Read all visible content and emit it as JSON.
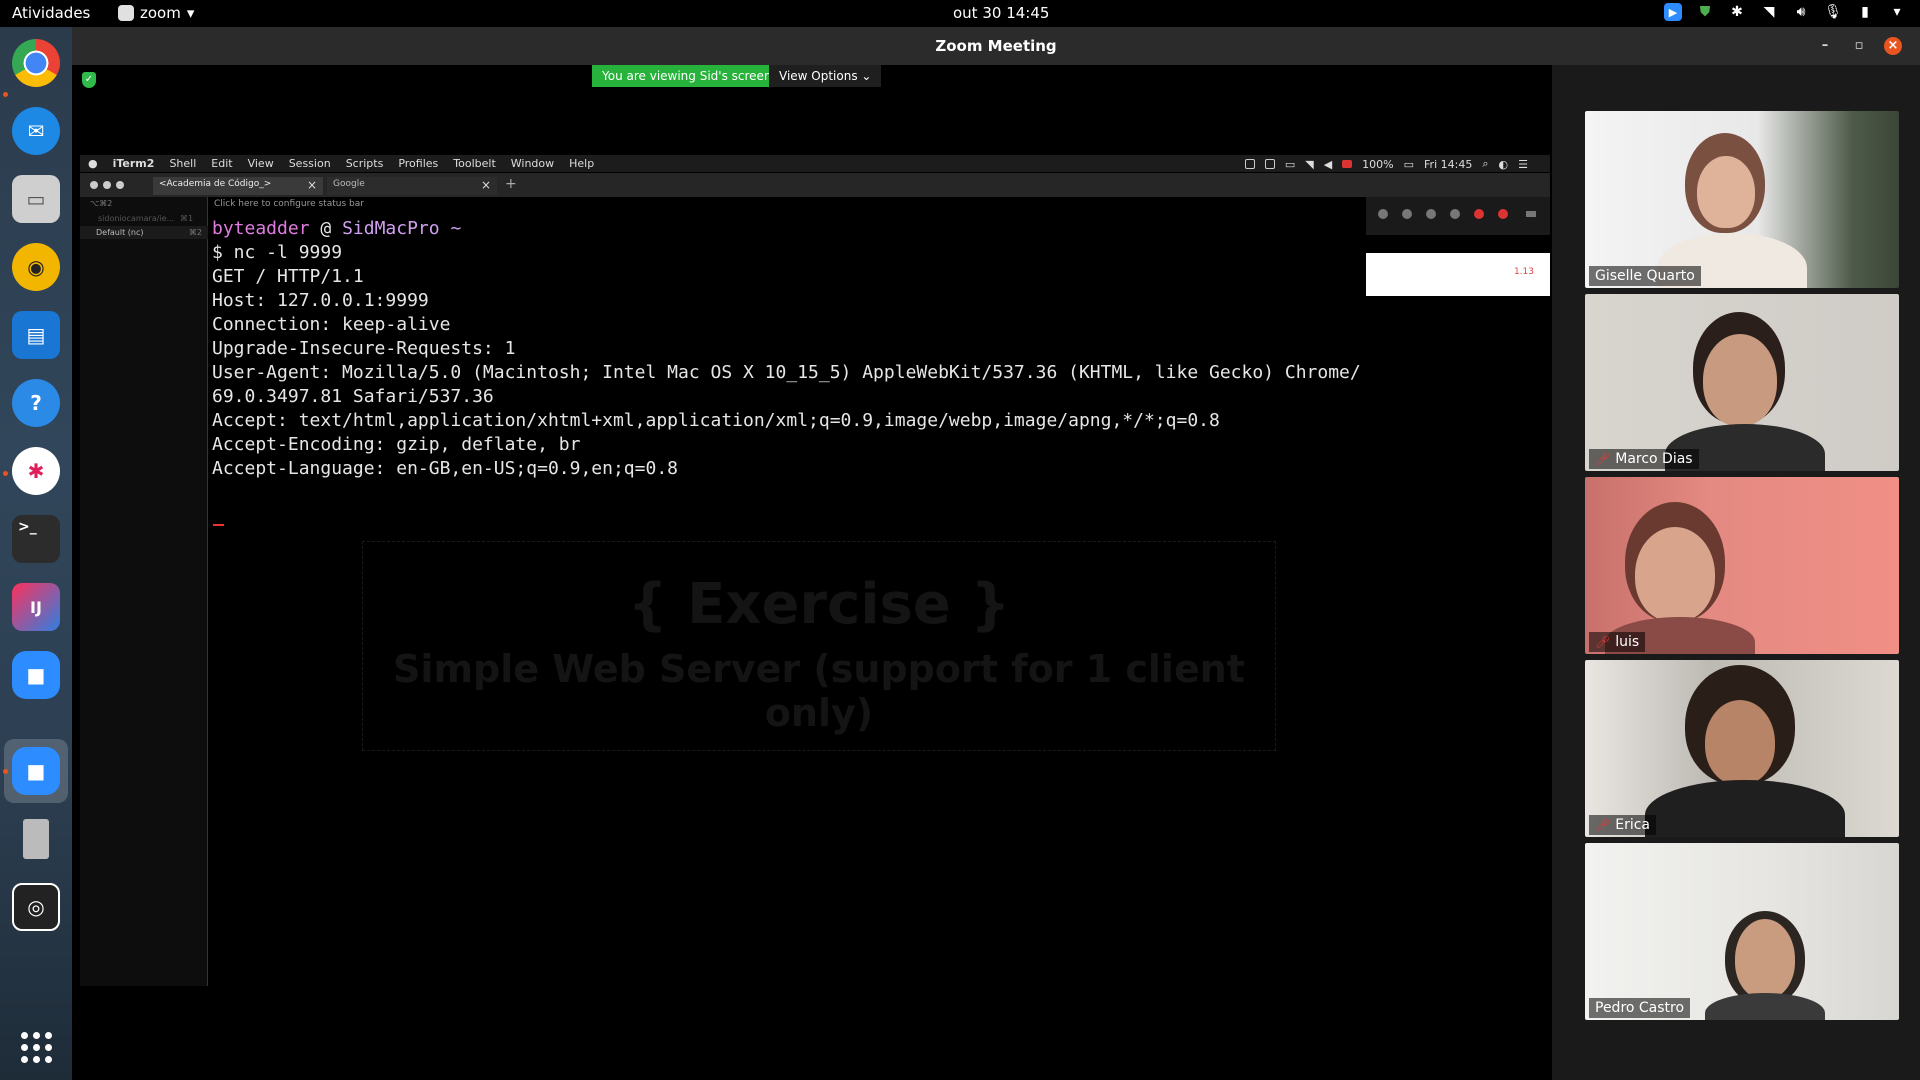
{
  "topbar": {
    "activities": "Atividades",
    "app_menu": "zoom",
    "datetime": "out 30  14:45"
  },
  "zoom": {
    "window_title": "Zoom Meeting",
    "viewing_banner": "You are viewing Sid's screen",
    "view_options": "View Options"
  },
  "mac": {
    "menus": [
      "iTerm2",
      "Shell",
      "Edit",
      "View",
      "Session",
      "Scripts",
      "Profiles",
      "Toolbelt",
      "Window",
      "Help"
    ],
    "battery": "100%",
    "clock": "Fri 14:45"
  },
  "iterm": {
    "tabs": [
      {
        "label": "<Academia de Código_>"
      },
      {
        "label": "Google"
      }
    ],
    "sidebar": {
      "row1": "sidoniocamara/ie...",
      "row1_kb": "⌘1",
      "row2_kb": "⌥⌘2",
      "profile": "Default (nc)",
      "profile_kb": "⌘2"
    },
    "statusbar_hint": "Click here to configure status bar",
    "prompt_user": "byteadder",
    "prompt_at": " @ ",
    "prompt_host": "SidMacPro",
    "prompt_tilde": " ~",
    "lines": [
      "$ nc -l 9999",
      "GET / HTTP/1.1",
      "Host: 127.0.0.1:9999",
      "Connection: keep-alive",
      "Upgrade-Insecure-Requests: 1",
      "User-Agent: Mozilla/5.0 (Macintosh; Intel Mac OS X 10_15_5) AppleWebKit/537.36 (KHTML, like Gecko) Chrome/",
      "69.0.3497.81 Safari/537.36",
      "Accept: text/html,application/xhtml+xml,application/xml;q=0.9,image/webp,image/apng,*/*;q=0.8",
      "Accept-Encoding: gzip, deflate, br",
      "Accept-Language: en-GB,en-US;q=0.9,en;q=0.8"
    ],
    "background_title": "{ Exercise }",
    "background_subtitle": "Simple Web Server (support for 1 client only)",
    "mini_panel_text": "1.13"
  },
  "participants": [
    {
      "name": "Giselle Quarto",
      "muted": false
    },
    {
      "name": "Marco Dias",
      "muted": true
    },
    {
      "name": "luis",
      "muted": true
    },
    {
      "name": "Erica",
      "muted": true
    },
    {
      "name": "Pedro Castro",
      "muted": false
    }
  ],
  "colors": {
    "zoom_green": "#27b23b",
    "ubuntu_orange": "#e95420",
    "zoom_blue": "#2d8cff"
  }
}
